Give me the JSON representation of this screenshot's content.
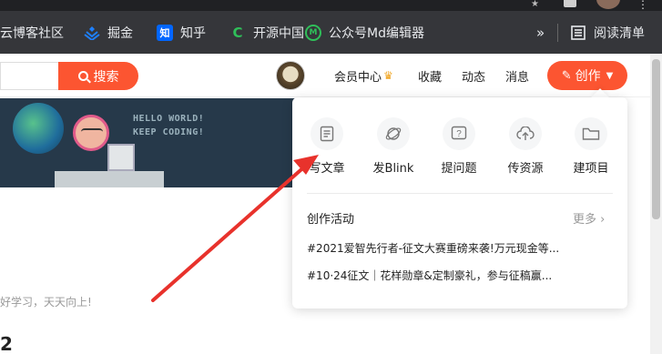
{
  "bookmarks": {
    "items": [
      {
        "label": "云博客社区",
        "icon": "cloud-blog-icon",
        "color": "#35363a"
      },
      {
        "label": "掘金",
        "icon": "juejin-icon",
        "color": "#1e80ff"
      },
      {
        "label": "知乎",
        "icon": "zhihu-icon",
        "glyph": "知",
        "color": "#0066ff"
      },
      {
        "label": "开源中国",
        "icon": "oschina-icon",
        "glyph": "C",
        "color": "#2fbf59"
      },
      {
        "label": "公众号Md编辑器",
        "icon": "md-editor-icon",
        "glyph": "M",
        "color": "#27ae60"
      }
    ],
    "overflow": "»",
    "reading_list": "阅读清单"
  },
  "header": {
    "search_button": "搜索",
    "nav": {
      "vip": "会员中心",
      "favorites": "收藏",
      "activity": "动态",
      "messages": "消息"
    },
    "create_button": "创作"
  },
  "banner": {
    "line1": "HELLO WORLD!",
    "line2": "KEEP CODING!"
  },
  "profile": {
    "tagline": "好学习，天天向上!",
    "number": "2"
  },
  "dropdown": {
    "items": [
      {
        "label": "写文章",
        "icon": "document-icon"
      },
      {
        "label": "发Blink",
        "icon": "planet-icon"
      },
      {
        "label": "提问题",
        "icon": "question-icon"
      },
      {
        "label": "传资源",
        "icon": "cloud-upload-icon"
      },
      {
        "label": "建项目",
        "icon": "folder-icon"
      }
    ],
    "section_title": "创作活动",
    "more": "更多",
    "links": [
      "#2021爱智先行者-征文大赛重磅来袭!万元现金等...",
      "#10·24征文｜花样勋章&定制豪礼，参与征稿赢..."
    ]
  },
  "colors": {
    "accent": "#fc5531",
    "arrow": "#e8322c"
  }
}
